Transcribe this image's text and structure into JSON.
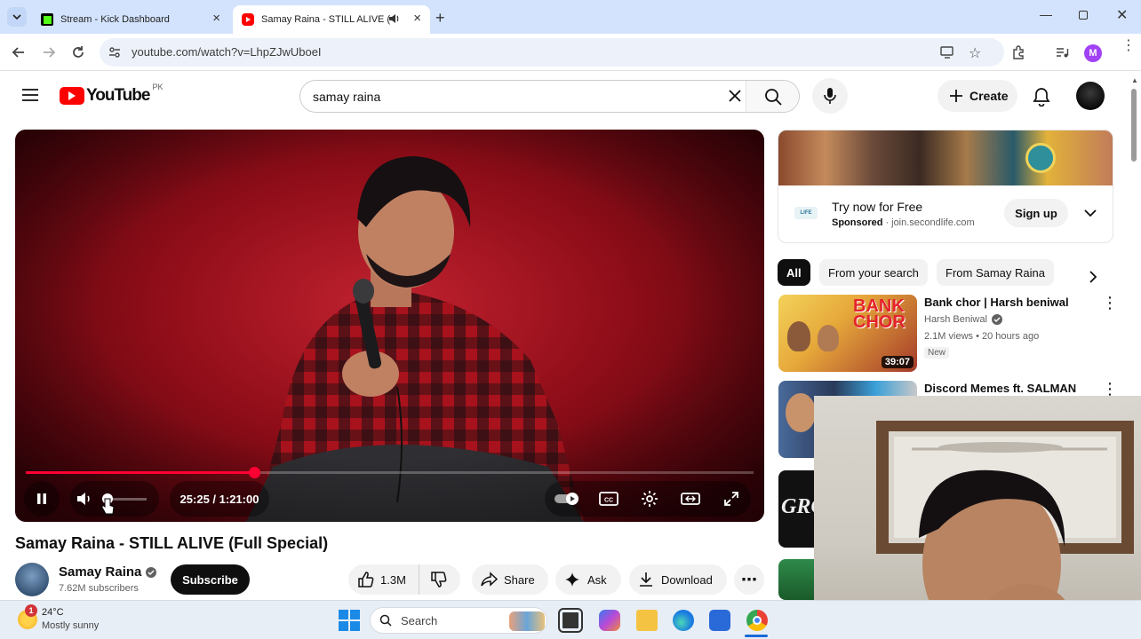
{
  "browser": {
    "tabs": [
      {
        "title": "Stream - Kick Dashboard",
        "favicon": "kick-logo",
        "color": "#53fc18"
      },
      {
        "title": "Samay Raina - STILL ALIVE (",
        "favicon": "youtube-logo",
        "color": "#ff0000",
        "audio_icon": "speaker-icon"
      }
    ],
    "new_tab_icon": "plus-icon",
    "url": "youtube.com/watch?v=LhpZJwUboeI",
    "profile_initial": "M"
  },
  "youtube": {
    "logo_text": "YouTube",
    "country": "PK",
    "search_query": "samay raina",
    "create_label": "Create",
    "video": {
      "current_time": "25:25",
      "duration": "1:21:00",
      "time_display": "25:25 / 1:21:00",
      "progress": 0.314,
      "volume": 0.05,
      "title": "Samay Raina - STILL ALIVE (Full Special)"
    },
    "channel": {
      "name": "Samay Raina",
      "subscribers": "7.62M subscribers",
      "subscribe_label": "Subscribe"
    },
    "actions": {
      "likes": "1.3M",
      "share": "Share",
      "ask": "Ask",
      "download": "Download"
    },
    "ad": {
      "title": "Try now for Free",
      "sponsored": "Sponsored",
      "domain": "join.secondlife.com",
      "cta": "Sign up"
    },
    "chips": [
      "All",
      "From your search",
      "From Samay Raina"
    ],
    "recommendations": [
      {
        "title": "Bank chor | Harsh beniwal",
        "channel": "Harsh Beniwal",
        "meta": "2.1M views • 20 hours ago",
        "badge": "New",
        "duration": "39:07",
        "thumb_text": "BANK CHOR"
      },
      {
        "title": "Discord Memes ft. SALMAN",
        "thumb_text": ""
      },
      {
        "title": "",
        "thumb_text": "GRO"
      }
    ]
  },
  "taskbar": {
    "weather_temp": "24°C",
    "weather_desc": "Mostly sunny",
    "notification_count": "1",
    "search_label": "Search"
  }
}
